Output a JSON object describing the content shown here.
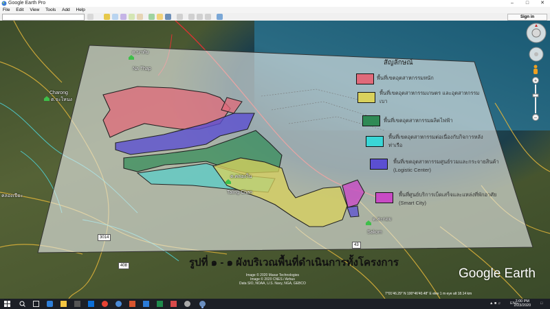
{
  "window": {
    "title": "Google Earth Pro"
  },
  "menu": [
    "File",
    "Edit",
    "View",
    "Tools",
    "Add",
    "Help"
  ],
  "toolbar": {
    "signin_label": "Sign in"
  },
  "map": {
    "places": [
      {
        "label": "Na Thap"
      },
      {
        "label": "Charong"
      },
      {
        "label": "ต.จะโหนง"
      },
      {
        "label": "ต.คลองใน"
      },
      {
        "label": "Taling Chan"
      },
      {
        "label": "Sakom"
      },
      {
        "label": "คลองเปียะ"
      },
      {
        "label": "ต.สะกอม"
      }
    ],
    "roads": [
      "3014",
      "408",
      "43"
    ],
    "credits": [
      "Image © 2020 Maxar Technologies",
      "Image © 2020 CNES / Airbus",
      "Data SIO, NOAA, U.S. Navy, NGA, GEBCO"
    ],
    "status": "7°01'46.29\" N  100°46'40.48\" E   elev  1 m   eye alt  18.14 km",
    "logo": "Google Earth"
  },
  "legend": {
    "title": "สัญลักษณ์",
    "items": [
      {
        "label": "พื้นที่เขตอุตสาหกรรมหนัก",
        "color": "#e06a7a"
      },
      {
        "label": "พื้นที่เขตอุตสาหกรรมเกษตร และอุตสาหกรรมเบา",
        "color": "#d9d15c"
      },
      {
        "label": "พื้นที่เขตอุตสาหกรรมผลิตไฟฟ้า",
        "color": "#2f8a55"
      },
      {
        "label": "พื้นที่เขตอุตสาหกรรมต่อเนื่องกับกิจการหลังท่าเรือ",
        "color": "#3ad6d6"
      },
      {
        "label": "พื้นที่เขตอุตสาหกรรมศูนย์รวมและกระจายสินค้า (Logistic Center)",
        "color": "#5b4fd1"
      },
      {
        "label": "พื้นที่ศูนย์บริการเบ็ดเสร็จและแหล่งที่พักอาศัย (Smart City)",
        "color": "#c84bc4"
      }
    ]
  },
  "caption": "รูปที่ ๑ - ๑ ผังบริเวณพื้นที่ดำเนินการทั้งโครงการ",
  "taskbar": {
    "time": "7:00 PM",
    "date": "2/23/2020",
    "lang": "ENG"
  }
}
